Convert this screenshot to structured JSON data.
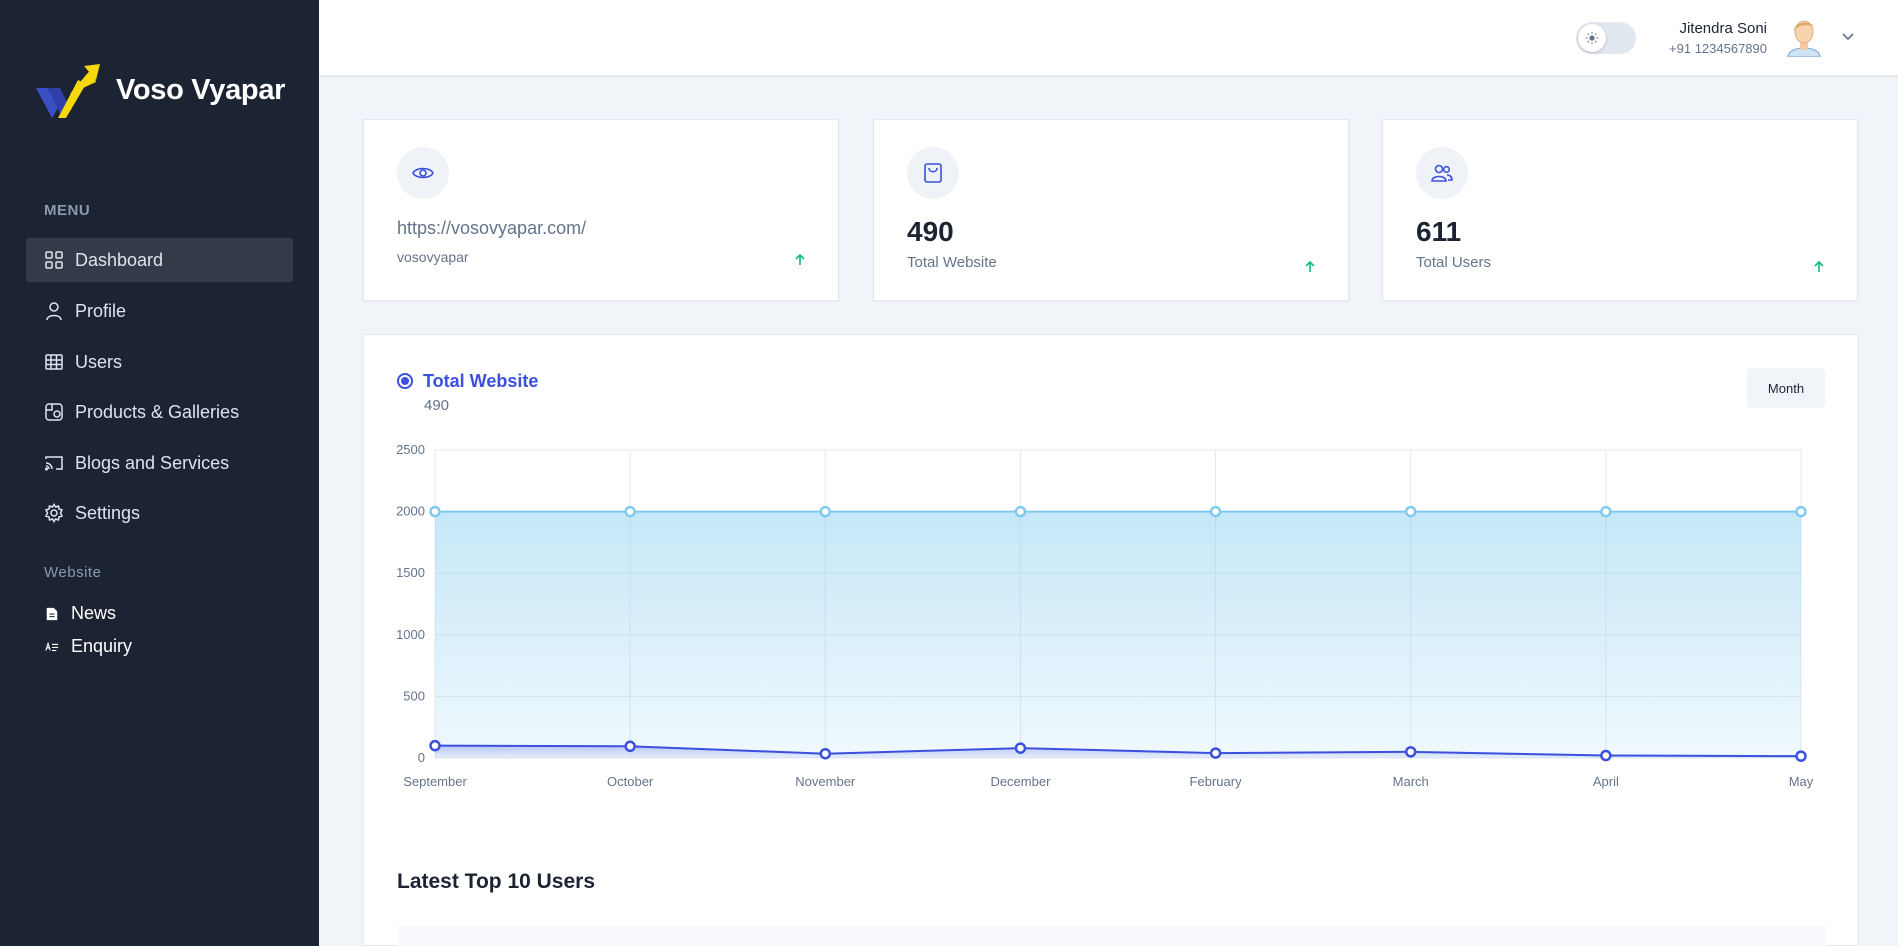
{
  "brand": {
    "name": "Voso Vyapar"
  },
  "sidebar": {
    "menu_heading": "MENU",
    "items": [
      {
        "label": "Dashboard",
        "icon": "grid-icon"
      },
      {
        "label": "Profile",
        "icon": "user-icon"
      },
      {
        "label": "Users",
        "icon": "table-icon"
      },
      {
        "label": "Products & Galleries",
        "icon": "package-icon"
      },
      {
        "label": "Blogs and Services",
        "icon": "cast-icon"
      },
      {
        "label": "Settings",
        "icon": "gear-icon"
      }
    ],
    "website_heading": "Website",
    "website_items": [
      {
        "label": "News",
        "icon": "document-icon"
      },
      {
        "label": "Enquiry",
        "icon": "list-text-icon"
      }
    ]
  },
  "header": {
    "user_name": "Jitendra Soni",
    "user_phone": "+91 1234567890"
  },
  "cards": [
    {
      "url": "https://vosovyapar.com/",
      "sub": "vosovyapar",
      "icon": "eye-icon"
    },
    {
      "value": "490",
      "label": "Total Website",
      "icon": "shopping-bag-icon"
    },
    {
      "value": "611",
      "label": "Total Users",
      "icon": "users-icon"
    }
  ],
  "chart_panel": {
    "series_name": "Total Website",
    "series_value": "490",
    "period_button": "Month"
  },
  "chart_data": {
    "type": "area",
    "categories": [
      "September",
      "October",
      "November",
      "December",
      "February",
      "March",
      "April",
      "May"
    ],
    "series": [
      {
        "values": [
          2000,
          2000,
          2000,
          2000,
          2000,
          2000,
          2000,
          2000
        ],
        "color": "#80caee"
      },
      {
        "values": [
          100,
          95,
          35,
          80,
          40,
          50,
          20,
          15
        ],
        "color": "#3c50e0"
      }
    ],
    "yticks": [
      "2500",
      "2000",
      "1500",
      "1000",
      "500",
      "0"
    ],
    "ylim": [
      0,
      2500
    ],
    "grid": true
  },
  "table": {
    "title": "Latest Top 10 Users"
  },
  "colors": {
    "sidebar": "#1c2434",
    "accent": "#3c50e0",
    "area": "#80caee",
    "success": "#10b981"
  }
}
